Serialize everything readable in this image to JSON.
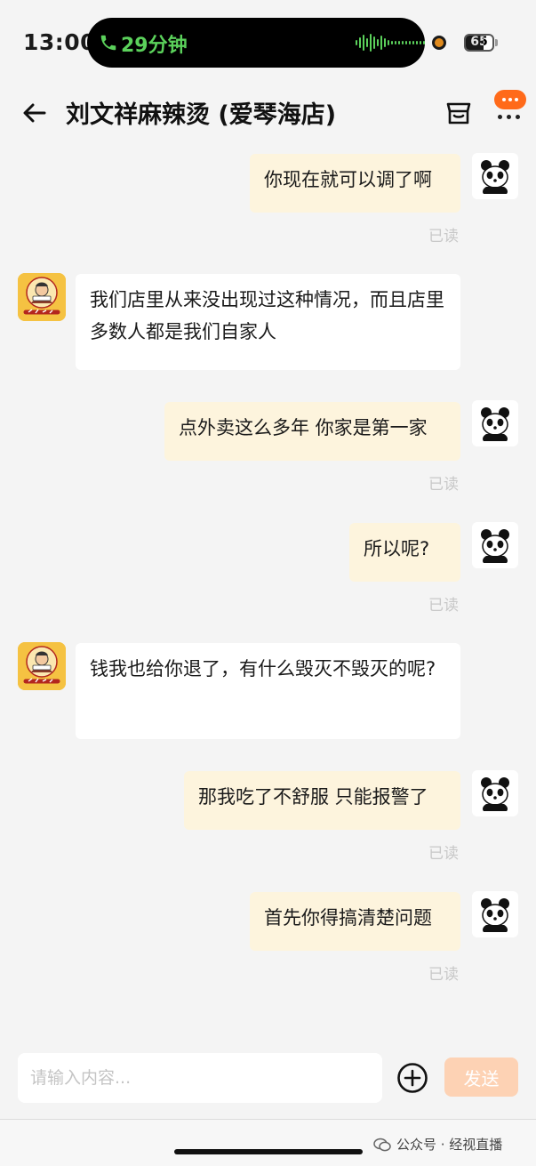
{
  "status_bar": {
    "time": "13:00",
    "call_duration": "29分钟",
    "battery": "65"
  },
  "header": {
    "title": "刘文祥麻辣烫 (爱琴海店)"
  },
  "shop_avatar_text": "刘文祥",
  "messages": [
    {
      "from": "me",
      "text": "你现在就可以调了啊",
      "status": "已读"
    },
    {
      "from": "shop",
      "text": "我们店里从来没出现过这种情况，而且店里多数人都是我们自家人"
    },
    {
      "from": "me",
      "text": "点外卖这么多年 你家是第一家",
      "status": "已读"
    },
    {
      "from": "me",
      "text": "所以呢?",
      "status": "已读"
    },
    {
      "from": "shop",
      "text": "钱我也给你退了，有什么毁灭不毁灭的呢?"
    },
    {
      "from": "me",
      "text": "那我吃了不舒服 只能报警了",
      "status": "已读"
    },
    {
      "from": "me",
      "text": "首先你得搞清楚问题",
      "status": "已读"
    }
  ],
  "composer": {
    "placeholder": "请输入内容...",
    "send_label": "发送"
  },
  "watermark": "公众号 · 经视直播",
  "colors": {
    "accent": "#ff6a1a",
    "my_bubble": "#fdf4dd",
    "call_green": "#5bd15b",
    "send_disabled": "#fdd2b4"
  }
}
